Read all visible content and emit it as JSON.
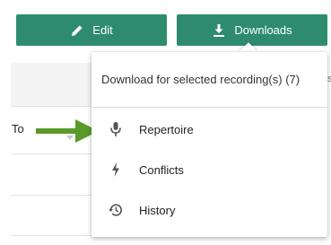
{
  "toolbar": {
    "edit_label": "Edit",
    "downloads_label": "Downloads",
    "button_color": "#2e8b6e"
  },
  "table": {
    "column_to": "To"
  },
  "dropdown": {
    "header": "Download for selected recording(s) (7)",
    "items": [
      {
        "label": "Repertoire",
        "icon": "microphone-icon"
      },
      {
        "label": "Conflicts",
        "icon": "lightning-bolt-icon"
      },
      {
        "label": "History",
        "icon": "history-icon"
      }
    ]
  },
  "annotation": {
    "arrow_color": "#5a9a2a",
    "points_to": "Repertoire"
  }
}
